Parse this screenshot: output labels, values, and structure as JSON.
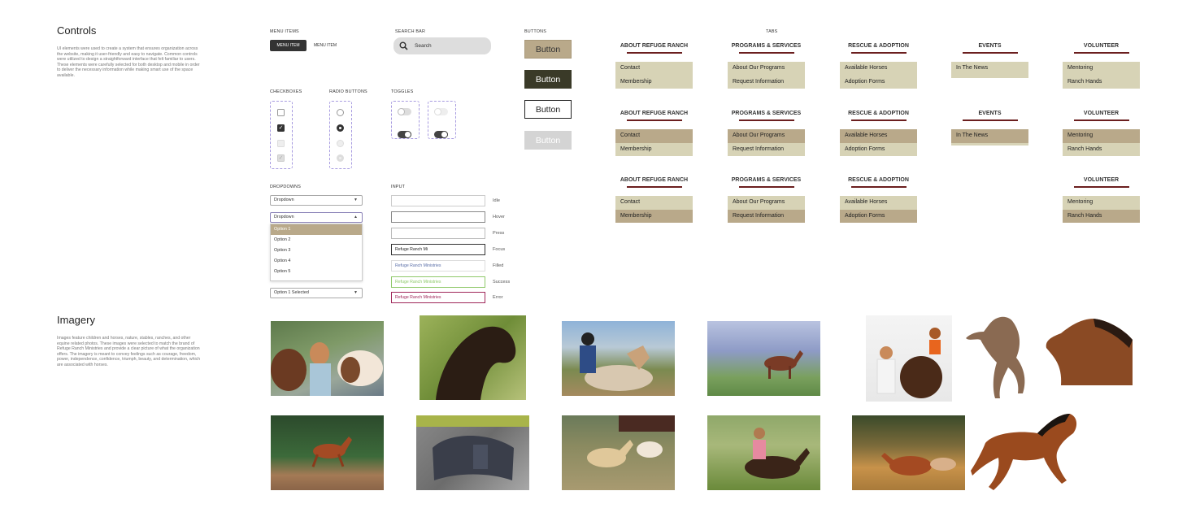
{
  "controls": {
    "title": "Controls",
    "description": "UI elements were used to create a system that ensures organization across the website, making it user-friendly and easy to navigate. Common controls were utilized to design a straightforward interface that felt familiar to users. These elements were carefully selected for both desktop and mobile in order to deliver the necessary information while making smart use of the space available."
  },
  "menu_items": {
    "label": "MENU ITEMS",
    "active": "MENU ITEM",
    "inactive": "MENU ITEM"
  },
  "search_bar": {
    "label": "SEARCH BAR",
    "placeholder": "Search"
  },
  "buttons": {
    "label": "BUTTONS",
    "items": [
      "Button",
      "Button",
      "Button",
      "Button"
    ]
  },
  "checkboxes": {
    "label": "CHECKBOXES",
    "check_glyph": "✓"
  },
  "radio_buttons": {
    "label": "RADIO BUTTONS"
  },
  "toggles": {
    "label": "TOGGLES"
  },
  "dropdowns": {
    "label": "DROPDOWNS",
    "closed_value": "Dropdown",
    "open_value": "Dropdown",
    "options": [
      "Option 1",
      "Option 2",
      "Option 3",
      "Option 4",
      "Option 5"
    ],
    "selected_value": "Option 1 Selected"
  },
  "input": {
    "label": "INPUT",
    "states": [
      {
        "state": "Idle",
        "value": "",
        "color": "#cccccc"
      },
      {
        "state": "Hover",
        "value": "",
        "color": "#888888"
      },
      {
        "state": "Press",
        "value": "",
        "color": "#aaaaaa"
      },
      {
        "state": "Focus",
        "value": "Refuge Ranch Mi",
        "color": "#555555"
      },
      {
        "state": "Filled",
        "value": "Refuge Ranch Ministries",
        "color": "#5b6fa8"
      },
      {
        "state": "Success",
        "value": "Refuge Ranch Ministries",
        "color": "#8fc96a"
      },
      {
        "state": "Error",
        "value": "Refuge Ranch Ministries",
        "color": "#a0285a"
      }
    ]
  },
  "tabs": {
    "label": "TABS",
    "columns": [
      {
        "title": "ABOUT REFUGE RANCH",
        "items": [
          "Contact",
          "Membership"
        ]
      },
      {
        "title": "PROGRAMS & SERVICES",
        "items": [
          "About Our Programs",
          "Request Information"
        ]
      },
      {
        "title": "RESCUE & ADOPTION",
        "items": [
          "Available Horses",
          "Adoption Forms"
        ]
      },
      {
        "title": "EVENTS",
        "items": [
          "In The News"
        ]
      },
      {
        "title": "VOLUNTEER",
        "items": [
          "Mentoring",
          "Ranch Hands"
        ]
      }
    ]
  },
  "imagery": {
    "title": "Imagery",
    "description": "Images feature children and horses, nature, stables, ranches, and other equine related photos. These images were selected to match the brand of Refuge Ranch Ministries and provide a clear picture of what the organization offers. The imagery is meant to convey feelings such as courage, freedom, power, independence, confidence, triumph, beauty, and determination, which are associated with horses."
  },
  "colors": {
    "accent_tan": "#b9a98a",
    "panel_beige": "#d7d3b6",
    "dark_olive": "#3a3a28",
    "maroon": "#6b1f1f"
  }
}
